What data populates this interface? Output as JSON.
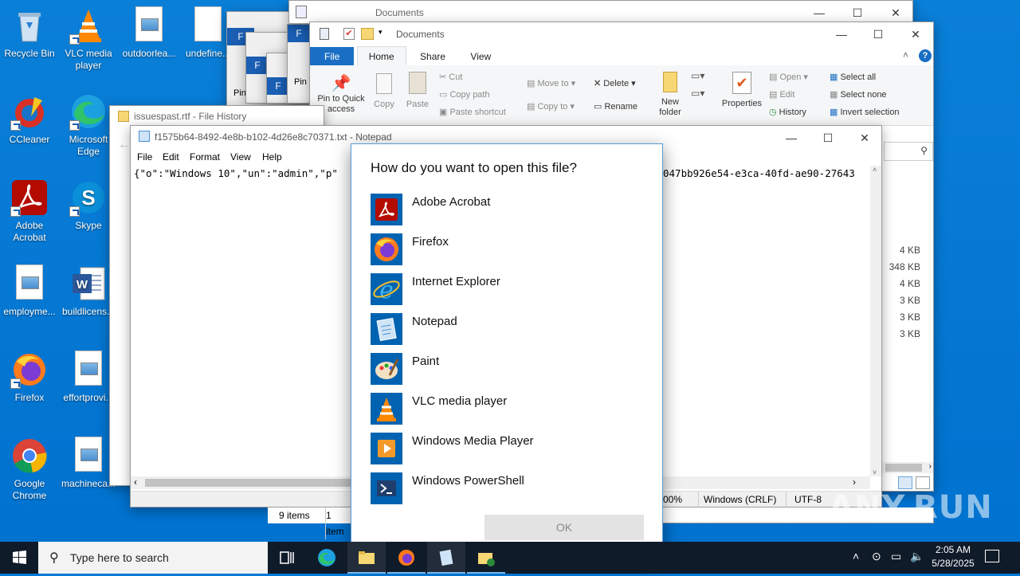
{
  "desktop_icons": [
    {
      "label": "Recycle Bin",
      "icon": "recycle-bin-icon"
    },
    {
      "label": "VLC media player",
      "icon": "vlc-icon"
    },
    {
      "label": "outdoorlea...",
      "icon": "image-file-icon"
    },
    {
      "label": "undefine...",
      "icon": "blank-file-icon"
    },
    {
      "label": "CCleaner",
      "icon": "ccleaner-icon"
    },
    {
      "label": "Microsoft Edge",
      "icon": "edge-icon"
    },
    {
      "label": "Adobe Acrobat",
      "icon": "acrobat-icon"
    },
    {
      "label": "Skype",
      "icon": "skype-icon"
    },
    {
      "label": "employme...",
      "icon": "image-file-icon"
    },
    {
      "label": "buildlicens...",
      "icon": "word-icon"
    },
    {
      "label": "Firefox",
      "icon": "firefox-icon"
    },
    {
      "label": "effortprovi...",
      "icon": "image-file-icon"
    },
    {
      "label": "Google Chrome",
      "icon": "chrome-icon"
    },
    {
      "label": "machineca...",
      "icon": "image-file-icon"
    }
  ],
  "explorer_back": {
    "title": "Documents"
  },
  "explorer": {
    "title": "Documents",
    "tabs": [
      "File",
      "Home",
      "Share",
      "View"
    ],
    "ribbon": {
      "pin": "Pin to Quick access",
      "copy": "Copy",
      "paste": "Paste",
      "cut": "Cut",
      "copy_path": "Copy path",
      "paste_shortcut": "Paste shortcut",
      "move_to": "Move to",
      "copy_to": "Copy to",
      "delete": "Delete",
      "rename": "Rename",
      "new_folder": "New folder",
      "properties": "Properties",
      "open": "Open",
      "edit": "Edit",
      "history": "History",
      "select_all": "Select all",
      "select_none": "Select none",
      "invert_selection": "Invert selection"
    },
    "sizes": [
      "4 KB",
      "348 KB",
      "4 KB",
      "3 KB",
      "3 KB",
      "3 KB"
    ],
    "status_items": "9 items",
    "status_selected": "1 item"
  },
  "stack_windows": {
    "f": "F",
    "pin": "Pin"
  },
  "file_history": {
    "title": "issuespast.rtf - File History"
  },
  "notepad": {
    "title": "f1575b64-8492-4e8b-b102-4d26e8c70371.txt - Notepad",
    "menus": [
      "File",
      "Edit",
      "Format",
      "View",
      "Help"
    ],
    "content_left": "{\"o\":\"Windows 10\",\"un\":\"admin\",\"p\"",
    "content_right": "047bb926e54-e3ca-40fd-ae90-27643",
    "status": {
      "zoom": "00%",
      "eol": "Windows (CRLF)",
      "encoding": "UTF-8"
    }
  },
  "dialog": {
    "question": "How do you want to open this file?",
    "options": [
      {
        "name": "Adobe Acrobat",
        "icon": "acrobat-icon"
      },
      {
        "name": "Firefox",
        "icon": "firefox-icon"
      },
      {
        "name": "Internet Explorer",
        "icon": "internet-explorer-icon"
      },
      {
        "name": "Notepad",
        "icon": "notepad-icon"
      },
      {
        "name": "Paint",
        "icon": "paint-icon"
      },
      {
        "name": "VLC media player",
        "icon": "vlc-icon"
      },
      {
        "name": "Windows Media Player",
        "icon": "media-player-icon"
      },
      {
        "name": "Windows PowerShell",
        "icon": "powershell-icon"
      }
    ],
    "ok": "OK"
  },
  "taskbar": {
    "search_placeholder": "Type here to search",
    "time": "2:05 AM",
    "date": "5/28/2025"
  },
  "watermark": "ANY.RUN",
  "colors": {
    "accent": "#0078d7",
    "taskbar": "#101b2a",
    "dialog_border": "#5a9bd5"
  }
}
